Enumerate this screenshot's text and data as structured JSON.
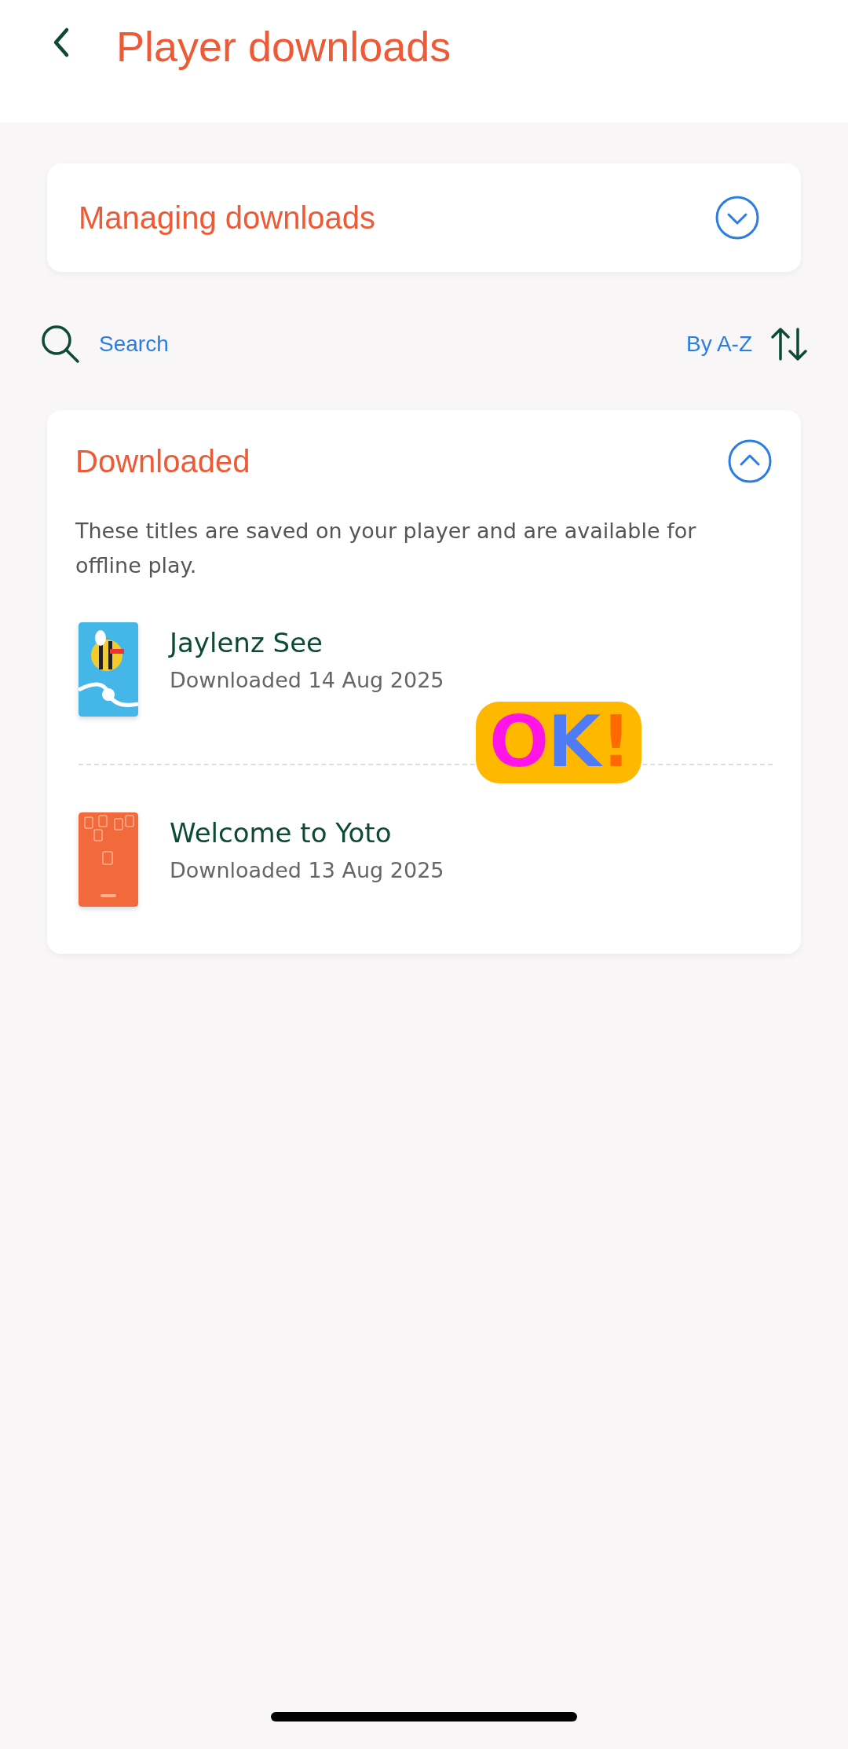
{
  "header": {
    "title": "Player downloads"
  },
  "info_card": {
    "title": "Managing downloads",
    "expanded": false
  },
  "toolbar": {
    "search_label": "Search",
    "sort_label": "By A-Z"
  },
  "downloaded_card": {
    "title": "Downloaded",
    "expanded": true,
    "description": "These titles are saved on your player and are available for offline play.",
    "items": [
      {
        "title": "Jaylenz See",
        "subtitle": "Downloaded 14 Aug 2025"
      },
      {
        "title": "Welcome to Yoto",
        "subtitle": "Downloaded 13 Aug 2025"
      }
    ]
  },
  "sticker": {
    "text": "OK!"
  }
}
